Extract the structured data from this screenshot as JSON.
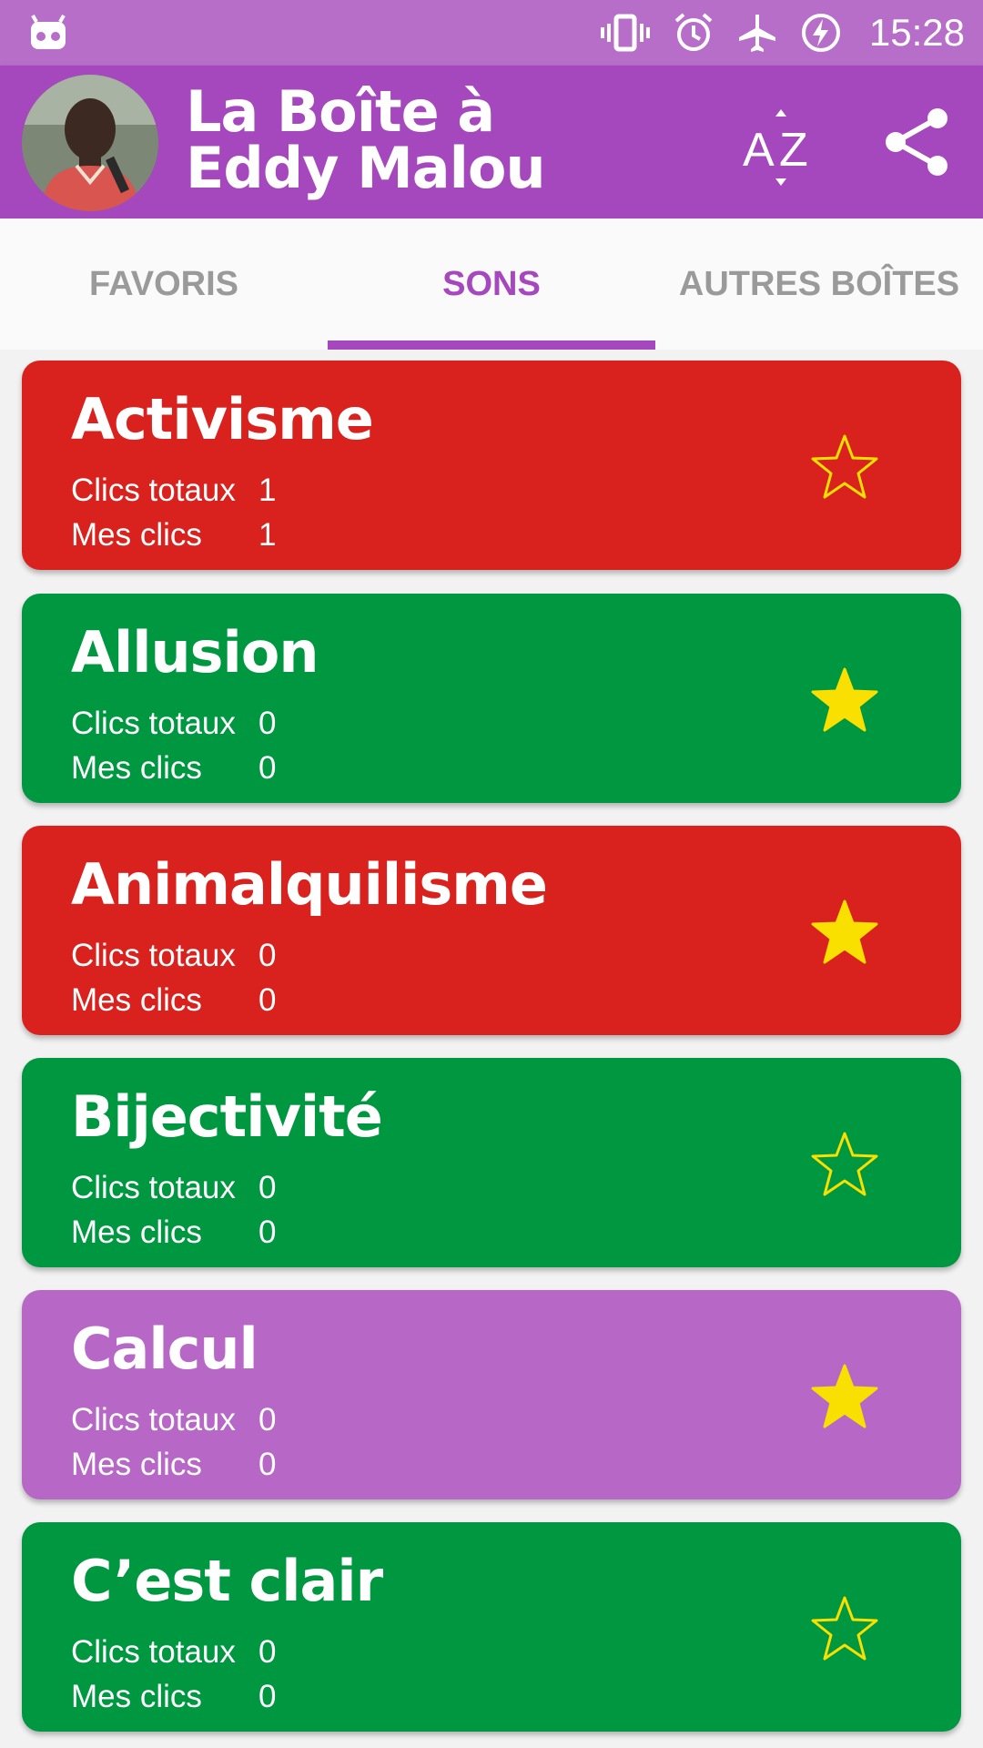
{
  "status_bar": {
    "time": "15:28",
    "icons": [
      "android-debug-icon",
      "vibrate-icon",
      "alarm-icon",
      "airplane-icon",
      "battery-charging-icon"
    ]
  },
  "app_bar": {
    "title": "La Boîte à Eddy Malou",
    "sort_icon": "sort-az-icon",
    "share_icon": "share-icon"
  },
  "tabs": [
    {
      "label": "FAVORIS",
      "active": false
    },
    {
      "label": "SONS",
      "active": true
    },
    {
      "label": "AUTRES BOÎTES",
      "active": false
    }
  ],
  "stat_labels": {
    "total": "Clics totaux",
    "mine": "Mes clics"
  },
  "colors": {
    "red": "#d9221e",
    "green": "#009741",
    "purple": "#b768c6",
    "appbar": "#a547bd",
    "star": "#f9e000"
  },
  "sounds": [
    {
      "title": "Activisme",
      "total": "1",
      "mine": "1",
      "color": "#d9221e",
      "favorite": false
    },
    {
      "title": "Allusion",
      "total": "0",
      "mine": "0",
      "color": "#009741",
      "favorite": true
    },
    {
      "title": "Animalquilisme",
      "total": "0",
      "mine": "0",
      "color": "#d9221e",
      "favorite": true
    },
    {
      "title": "Bijectivité",
      "total": "0",
      "mine": "0",
      "color": "#009741",
      "favorite": false
    },
    {
      "title": "Calcul",
      "total": "0",
      "mine": "0",
      "color": "#b768c6",
      "favorite": true
    },
    {
      "title": "C’est clair",
      "total": "0",
      "mine": "0",
      "color": "#009741",
      "favorite": false
    }
  ]
}
